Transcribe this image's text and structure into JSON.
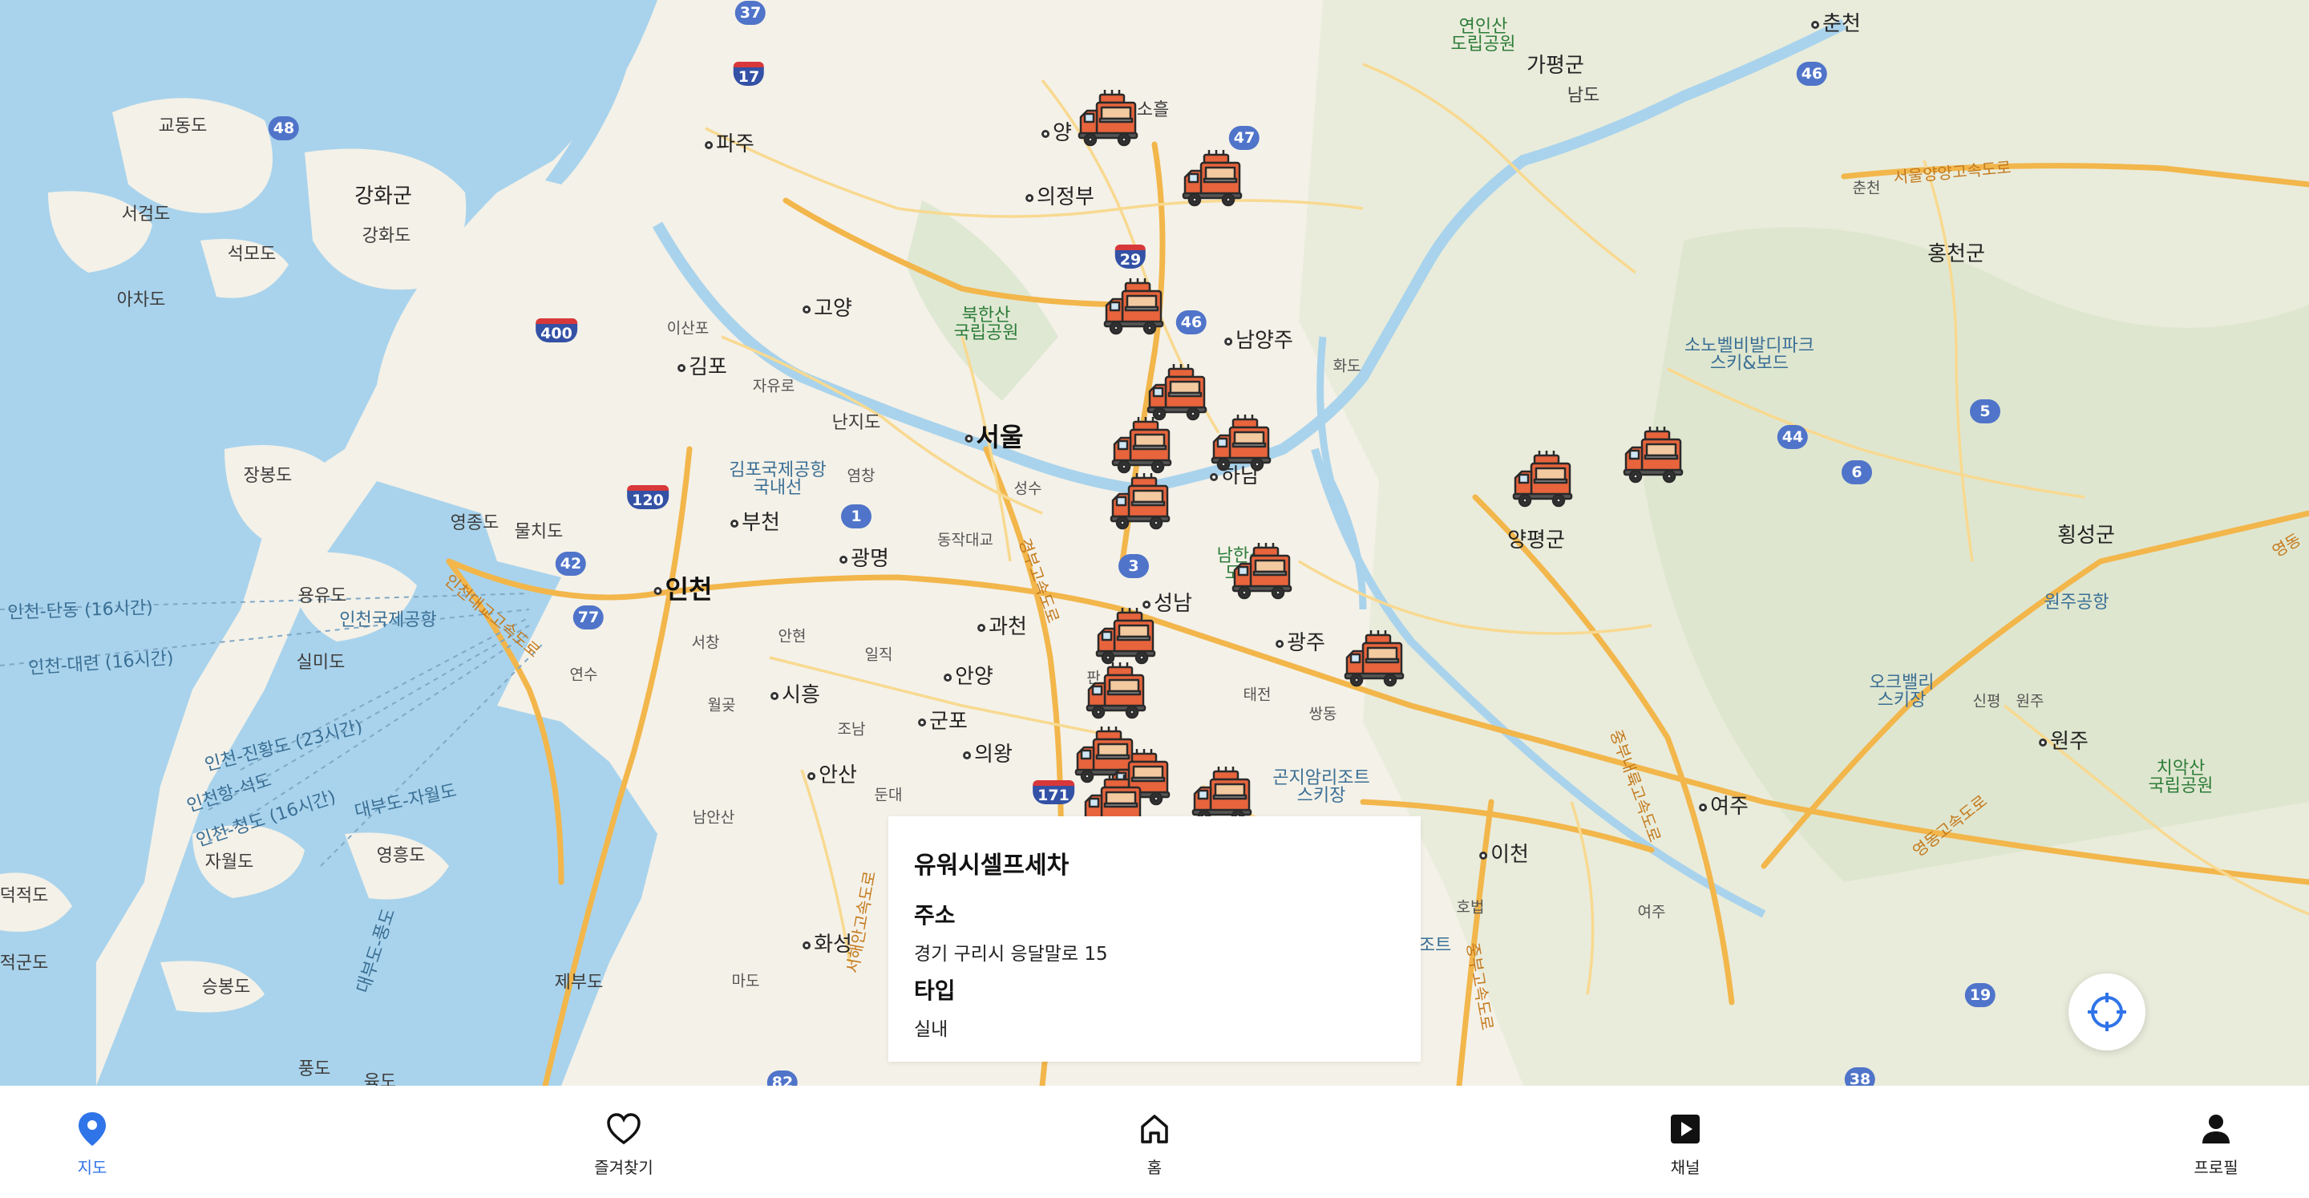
{
  "map": {
    "labels": {
      "chuncheon": "춘천",
      "yeonin": "연인산\n도립공원",
      "gapyeong": "가평군",
      "namdo": "남도",
      "gyodongdo": "교동도",
      "paju": "파주",
      "yang": "양",
      "sohol": "소흘",
      "uijeongbu": "의정부",
      "ganghwagun": "강화군",
      "ganghwado": "강화도",
      "seogeomdo": "서검도",
      "seokmodo": "석모도",
      "achado": "아차도",
      "goyang": "고양",
      "ilsanpo": "이산포",
      "bukhansan": "북한산\n국립공원",
      "namyangju": "남양주",
      "hwado": "화도",
      "chuncheon_jc": "춘천",
      "hongcheon": "홍천군",
      "sono": "소노벨비발디파크\n스키&보드",
      "gimpo": "김포",
      "jayuro": "자유로",
      "nanjido": "난지도",
      "seoul": "서울",
      "gimpo_airport": "김포국제공항\n국내선",
      "yeomchang": "염창",
      "seongsu": "성수",
      "hanam": "하남",
      "jangbongdo": "장봉도",
      "yeongjongdo": "영종도",
      "mulchido": "물치도",
      "bucheon": "부천",
      "dongjakdaegyo": "동작대교",
      "yangpyeong": "양평군",
      "hoengseong": "횡성군",
      "namhansan": "남한산\n도립",
      "incheon": "인천",
      "gwangmyeong": "광명",
      "yongyudo": "용유도",
      "incheon_airport": "인천국제공항",
      "wonju_airport": "원주공항",
      "route_dandong": "인천-단동 (16시간)",
      "route_dalian": "인천-대련 (16시간)",
      "silmido": "실미도",
      "seongnam": "성남",
      "gwacheon": "과천",
      "gwangju": "광주",
      "seochang": "서창",
      "anhyeon": "안현",
      "ilik": "일직",
      "yeonsu": "연수",
      "anyang": "안양",
      "pan": "판",
      "taejeon": "태전",
      "ssangdong": "쌍동",
      "oakvalley": "오크밸리\n스키장",
      "sinpyeong": "신평",
      "wonju_jc": "원주",
      "siheung": "시흥",
      "wolgot": "월곶",
      "joam": "조남",
      "gunpo": "군포",
      "uiwang": "의왕",
      "wonju": "원주",
      "route_jinhwangdo": "인천-진황도 (23시간)",
      "route_seokdo": "인천항-석도",
      "route_qingdao": "인천-청도 (16시간)",
      "daebu": "대부도-자월도",
      "ansan": "안산",
      "dunde": "둔대",
      "gonjiam": "곤지암리조트\n스키장",
      "yeoju": "여주",
      "chiak": "치악산\n국립공원",
      "jawoldo": "자월도",
      "yeongheungdo": "영흥도",
      "namansan": "남안산",
      "deokjeokdo": "덕적도",
      "icheon": "이천",
      "hwaseong": "화성",
      "hobeop": "호법",
      "yeoju_jc": "여주",
      "jeokgeumdo": "적군도",
      "seungbongdo": "승봉도",
      "jebudo": "제부도",
      "mado": "마도",
      "pungdo": "풍도",
      "yukdo": "육도",
      "seoul_yangyang": "서울양양고속도로",
      "jungbu_naeryuk": "중부내륙고속도로",
      "gyeongbu": "경부고속도로",
      "yeongdong": "영동고속도로",
      "jungbu": "중부고속도로",
      "seohaean": "서해안고속도로",
      "daebudo_road": "대부도-풍도",
      "incheon_bridge": "인천대교고속도로",
      "jo_teu": "조트",
      "yeongdong_east": "영동"
    },
    "shields": [
      "37",
      "17",
      "48",
      "47",
      "46",
      "29",
      "46",
      "400",
      "120",
      "42",
      "77",
      "1",
      "3",
      "44",
      "6",
      "5",
      "171",
      "19",
      "38",
      "82"
    ]
  },
  "info_card": {
    "name": "유워시셀프세차",
    "address_heading": "주소",
    "address": "경기 구리시 응달말로 15",
    "type_heading": "타입",
    "type": "실내"
  },
  "colors": {
    "water": "#a9d3ec",
    "accent": "#2f74e8",
    "truck_body": "#e8643c"
  },
  "icons": {
    "marker": "food-truck-icon",
    "locate": "crosshair-icon"
  },
  "tabs": [
    {
      "label": "지도",
      "icon": "map-pin-icon",
      "active": true
    },
    {
      "label": "즐겨찾기",
      "icon": "heart-icon",
      "active": false
    },
    {
      "label": "홈",
      "icon": "home-icon",
      "active": false
    },
    {
      "label": "채널",
      "icon": "play-icon",
      "active": false
    },
    {
      "label": "프로필",
      "icon": "profile-icon",
      "active": false
    }
  ]
}
